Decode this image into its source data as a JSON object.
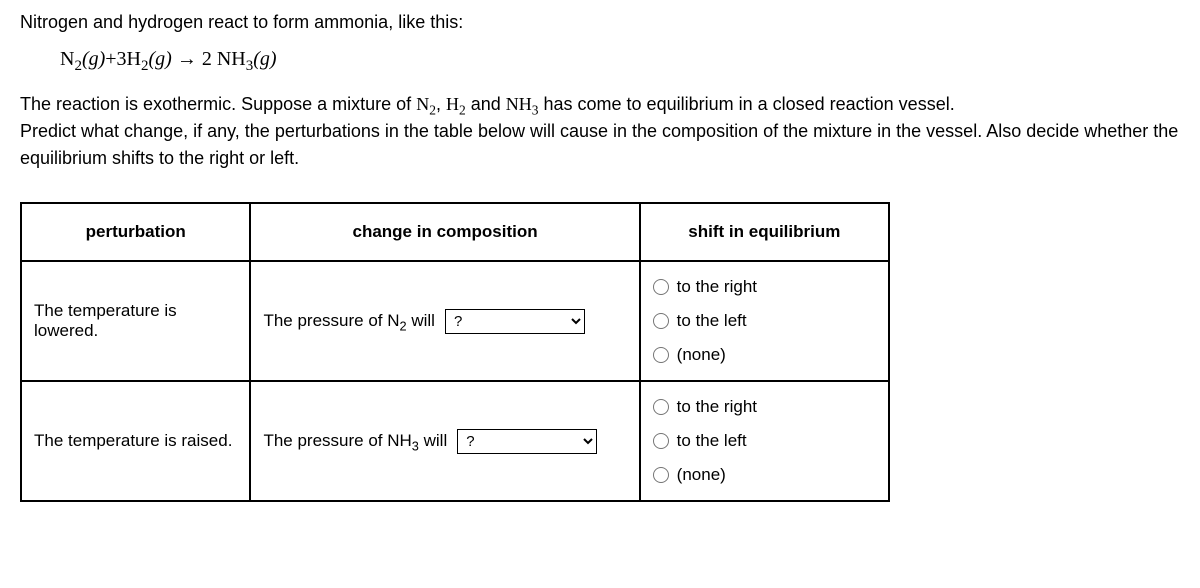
{
  "intro": "Nitrogen and hydrogen react to form ammonia, like this:",
  "equation_html": "N<span class=\"sub\">2</span>(<i>g</i>)+3H<span class=\"sub\">2</span>(<i>g</i>) → 2 NH<span class=\"sub\">3</span>(<i>g</i>)",
  "description_line1_before": "The reaction is exothermic. Suppose a mixture of ",
  "description_chem1": "N<span class=\"sub\">2</span>",
  "description_sep1": ", ",
  "description_chem2": "H<span class=\"sub\">2</span>",
  "description_sep2": " and ",
  "description_chem3": "NH<span class=\"sub\">3</span>",
  "description_line1_after": " has come to equilibrium in a closed reaction vessel.",
  "description_line2": "Predict what change, if any, the perturbations in the table below will cause in the composition of the mixture in the vessel. Also decide whether the equilibrium shifts to the right or left.",
  "table": {
    "headers": {
      "perturbation": "perturbation",
      "composition": "change in composition",
      "shift": "shift in equilibrium"
    },
    "rows": [
      {
        "perturbation": "The temperature is lowered.",
        "comp_prefix": "The pressure of N",
        "comp_sub": "2",
        "comp_suffix": " will",
        "select_value": "?",
        "radios": [
          "to the right",
          "to the left",
          "(none)"
        ]
      },
      {
        "perturbation": "The temperature is raised.",
        "comp_prefix": "The pressure of NH",
        "comp_sub": "3",
        "comp_suffix": " will",
        "select_value": "?",
        "radios": [
          "to the right",
          "to the left",
          "(none)"
        ]
      }
    ]
  }
}
